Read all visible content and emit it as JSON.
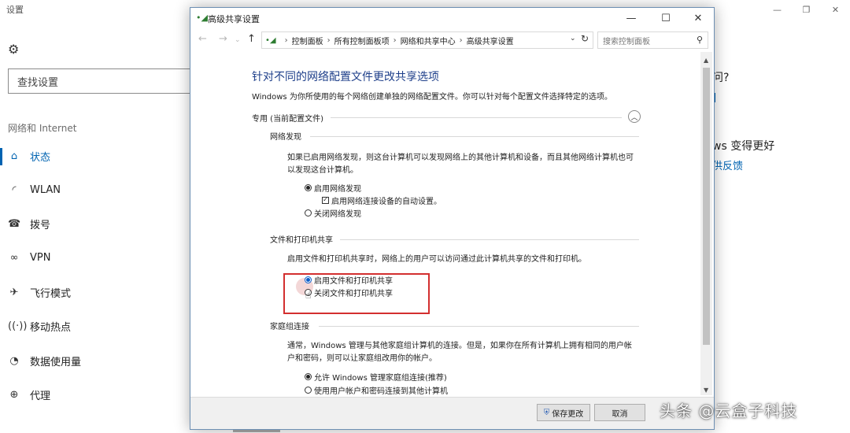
{
  "settings": {
    "title": "设置",
    "search_placeholder": "查找设置",
    "section": "网络和 Internet",
    "nav": [
      {
        "label": "状态",
        "icon": "home-icon",
        "active": true
      },
      {
        "label": "WLAN",
        "icon": "wifi-icon"
      },
      {
        "label": "拨号",
        "icon": "phone-icon"
      },
      {
        "label": "VPN",
        "icon": "vpn-icon"
      },
      {
        "label": "飞行模式",
        "icon": "airplane-icon"
      },
      {
        "label": "移动热点",
        "icon": "hotspot-icon"
      },
      {
        "label": "数据使用量",
        "icon": "data-usage-icon"
      },
      {
        "label": "代理",
        "icon": "globe-icon"
      }
    ],
    "right_question": "问?",
    "right_better": "ws 变得更好",
    "right_feedback": "供反馈"
  },
  "window": {
    "title": "高级共享设置",
    "address": {
      "crumbs": [
        "控制面板",
        "所有控制面板项",
        "网络和共享中心",
        "高级共享设置"
      ],
      "search_placeholder": "搜索控制面板"
    },
    "heading": "针对不同的网络配置文件更改共享选项",
    "description": "Windows 为你所使用的每个网络创建单独的网络配置文件。你可以针对每个配置文件选择特定的选项。",
    "profile": "专用 (当前配置文件)",
    "sections": {
      "discovery": {
        "title": "网络发现",
        "text": "如果已启用网络发现，则这台计算机可以发现网络上的其他计算机和设备，而且其他网络计算机也可以发现这台计算机。",
        "on": "启用网络发现",
        "auto": "启用网络连接设备的自动设置。",
        "off": "关闭网络发现"
      },
      "file_sharing": {
        "title": "文件和打印机共享",
        "text": "启用文件和打印机共享时，网络上的用户可以访问通过此计算机共享的文件和打印机。",
        "on": "启用文件和打印机共享",
        "off": "关闭文件和打印机共享"
      },
      "homegroup": {
        "title": "家庭组连接",
        "text": "通常，Windows 管理与其他家庭组计算机的连接。但是，如果你在所有计算机上拥有相同的用户帐户和密码，则可以让家庭组改用你的帐户。",
        "allow": "允许 Windows 管理家庭组连接(推荐)",
        "user": "使用用户帐户和密码连接到其他计算机"
      }
    },
    "buttons": {
      "save": "保存更改",
      "cancel": "取消"
    }
  },
  "watermark": "头条 @云盒子科技",
  "colors": {
    "accent": "#0063b1",
    "heading": "#1e3f8a",
    "highlight": "#d32f2f"
  }
}
